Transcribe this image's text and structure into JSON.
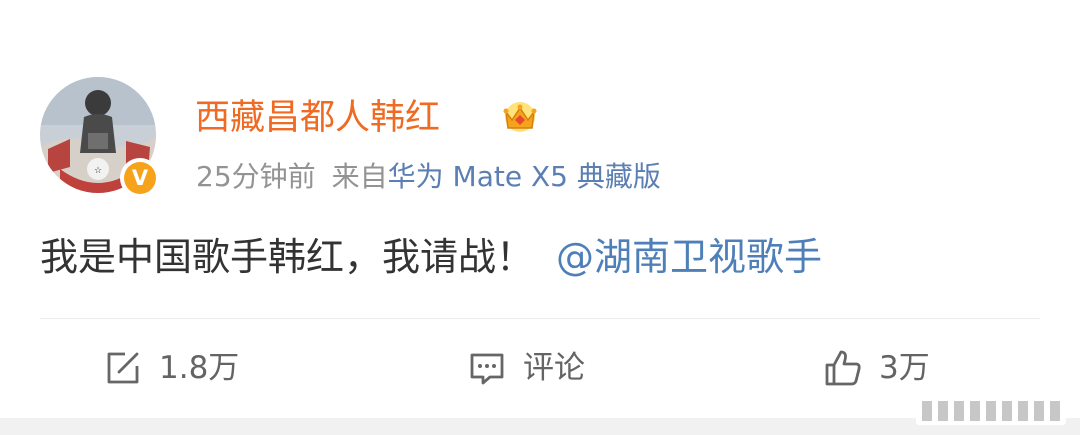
{
  "post": {
    "username": "西藏昌都人韩红",
    "crown_icon": "vip-crown-icon",
    "verified_badge": "V",
    "time": "25分钟前",
    "source_prefix": "来自",
    "device": "华为 Mate X5 典藏版",
    "text": "我是中国歌手韩红，我请战！",
    "mention": "@湖南卫视歌手"
  },
  "actions": {
    "repost": {
      "icon": "share-icon",
      "count": "1.8万"
    },
    "comment": {
      "icon": "comment-icon",
      "label": "评论"
    },
    "like": {
      "icon": "thumbs-up-icon",
      "count": "3万"
    }
  },
  "colors": {
    "username": "#ef6a23",
    "link": "#4e7fb8",
    "meta": "#939393",
    "verified": "#f7a21b"
  }
}
